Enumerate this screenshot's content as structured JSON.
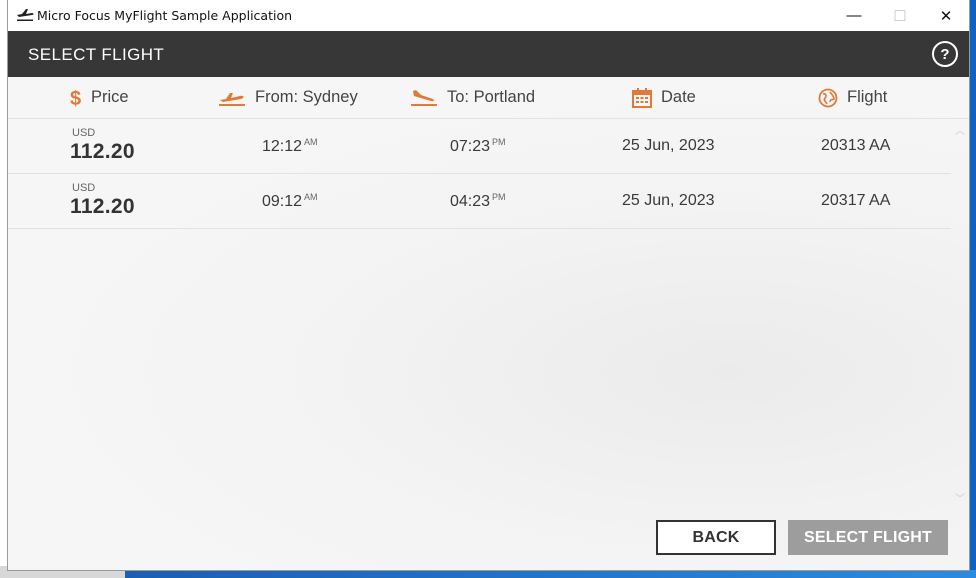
{
  "window": {
    "title": "Micro Focus MyFlight Sample Application",
    "controls": {
      "minimize": "—",
      "maximize": "☐",
      "close": "✕"
    }
  },
  "header": {
    "title": "SELECT FLIGHT",
    "help_label": "?"
  },
  "columns": {
    "price": "Price",
    "from": "From: Sydney",
    "to": "To: Portland",
    "date": "Date",
    "flight": "Flight"
  },
  "flights": [
    {
      "currency": "USD",
      "price": "112.20",
      "depart_time": "12:12",
      "depart_ampm": "AM",
      "arrive_time": "07:23",
      "arrive_ampm": "PM",
      "date": "25 Jun, 2023",
      "flight": "20313 AA"
    },
    {
      "currency": "USD",
      "price": "112.20",
      "depart_time": "09:12",
      "depart_ampm": "AM",
      "arrive_time": "04:23",
      "arrive_ampm": "PM",
      "date": "25 Jun, 2023",
      "flight": "20317 AA"
    }
  ],
  "buttons": {
    "back": "BACK",
    "select": "SELECT FLIGHT"
  },
  "colors": {
    "accent": "#e07a3a",
    "header_bg": "#373737",
    "select_button_disabled": "#9d9d9d"
  },
  "icons": {
    "price": "dollar-icon",
    "from": "takeoff-icon",
    "to": "landing-icon",
    "date": "calendar-icon",
    "flight": "globe-icon",
    "help": "help-icon"
  }
}
